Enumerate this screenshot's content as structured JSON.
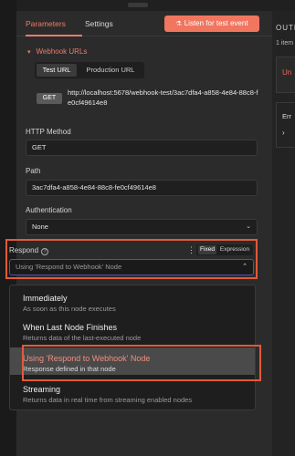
{
  "tabs": [
    {
      "label": "Parameters"
    },
    {
      "label": "Settings"
    }
  ],
  "listen_button": "Listen for test event",
  "webhook_section": "Webhook URLs",
  "url_toggle": [
    "Test URL",
    "Production URL"
  ],
  "method_badge": "GET",
  "webhook_url": "http://localhost:5678/webhook-test/3ac7dfa4-a858-4e84-88c8-fe0cf49614e8",
  "http_method": {
    "label": "HTTP Method",
    "value": "GET"
  },
  "path": {
    "label": "Path",
    "value": "3ac7dfa4-a858-4e84-88c8-fe0cf49614e8"
  },
  "authentication": {
    "label": "Authentication",
    "value": "None"
  },
  "respond": {
    "label": "Respond",
    "mode": [
      "Fixed",
      "Expression"
    ],
    "value": "Using 'Respond to Webhook' Node"
  },
  "options": [
    {
      "title": "Immediately",
      "desc": "As soon as this node executes"
    },
    {
      "title": "When Last Node Finishes",
      "desc": "Returns data of the last-executed node"
    },
    {
      "title": "Using 'Respond to Webhook' Node",
      "desc": "Response defined in that node"
    },
    {
      "title": "Streaming",
      "desc": "Returns data in real time from streaming enabled nodes"
    }
  ],
  "right_panel": {
    "title": "OUTPUT",
    "items": "1 item",
    "card1": "Un",
    "card2": "Err"
  },
  "colors": {
    "accent": "#ef7b6a",
    "highlight_border": "#e25a3a"
  }
}
